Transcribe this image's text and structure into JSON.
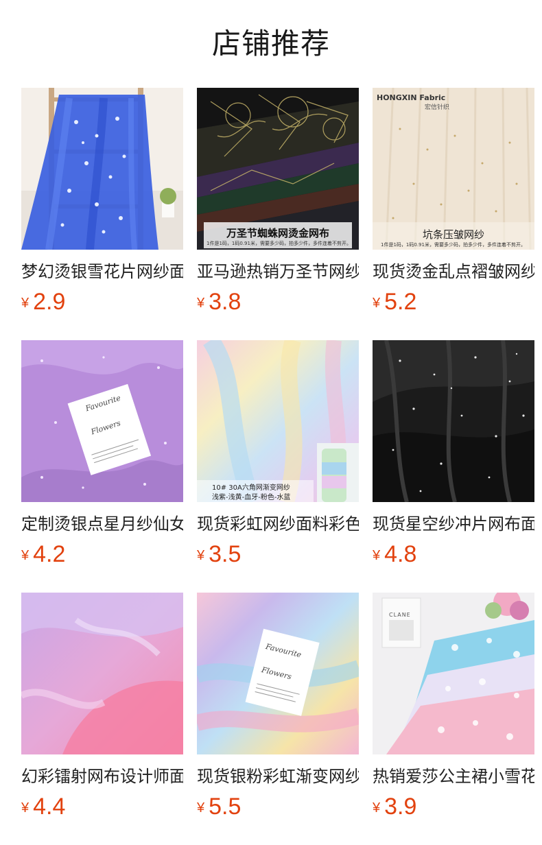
{
  "page": {
    "title": "店铺推荐"
  },
  "currency_symbol": "¥",
  "products": [
    {
      "name": "梦幻烫银雪花片网纱面料",
      "price": "2.9"
    },
    {
      "name": "亚马逊热销万圣节网纱面料",
      "price": "3.8"
    },
    {
      "name": "现货烫金乱点褶皱网纱面料",
      "price": "5.2"
    },
    {
      "name": "定制烫银点星月纱仙女裙",
      "price": "4.2"
    },
    {
      "name": "现货彩虹网纱面料彩色渐变",
      "price": "3.5"
    },
    {
      "name": "现货星空纱冲片网布面料",
      "price": "4.8"
    },
    {
      "name": "幻彩镭射网布设计师面料",
      "price": "4.4"
    },
    {
      "name": "现货银粉彩虹渐变网纱面料",
      "price": "5.5"
    },
    {
      "name": "热销爱莎公主裙小雪花网纱",
      "price": "3.9"
    }
  ],
  "image_text": {
    "p2": {
      "caption": "万圣节蜘蛛网烫金网布",
      "sub": "1件是1码，1码0.91米，需要多少码，拍多少件，多件连着不剪开。"
    },
    "p3": {
      "brand": "HONGXIN Fabric",
      "brand_cn": "宏信针织",
      "caption": "坑条压皱网纱",
      "sub": "1件是1码，1码0.91米，需要多少码，拍多少件，多件连着不剪开。"
    },
    "p4": {
      "card_line1": "Favourite",
      "card_line2": "Flowers"
    },
    "p5": {
      "line1": "10# 30A六角网渐变网纱",
      "line2": "浅紫-浅黄-血牙-粉色-水蓝"
    },
    "p8": {
      "card_line1": "Favourite",
      "card_line2": "Flowers"
    },
    "p9": {
      "frame": "CLANE"
    }
  }
}
